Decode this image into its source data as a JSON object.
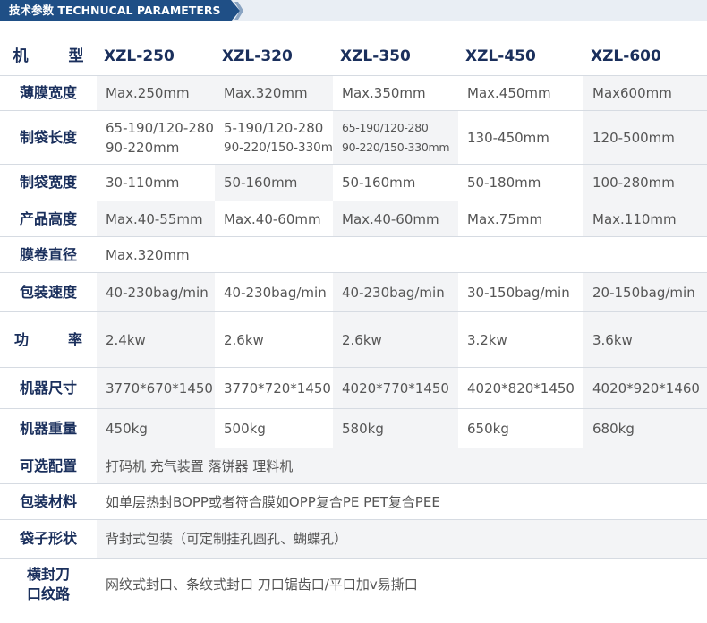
{
  "header": {
    "title": "技术参数 TECHNUCAL PARAMETERS"
  },
  "table": {
    "columns": [
      "机　型",
      "XZL-250",
      "XZL-320",
      "XZL-350",
      "XZL-450",
      "XZL-600"
    ],
    "rows": [
      {
        "label": "薄膜宽度",
        "values": [
          "Max.250mm",
          "Max.320mm",
          "Max.350mm",
          "Max.450mm",
          "Max600mm"
        ]
      },
      {
        "label": "制袋长度",
        "values": [
          [
            "65-190/120-280",
            "90-220mm"
          ],
          [
            "5-190/120-280",
            "90-220/150-330mm"
          ],
          [
            "65-190/120-280",
            "90-220/150-330mm"
          ],
          "130-450mm",
          "120-500mm"
        ]
      },
      {
        "label": "制袋宽度",
        "values": [
          "30-110mm",
          "50-160mm",
          "50-160mm",
          "50-180mm",
          "100-280mm"
        ]
      },
      {
        "label": "产品高度",
        "values": [
          "Max.40-55mm",
          "Max.40-60mm",
          "Max.40-60mm",
          "Max.75mm",
          "Max.110mm"
        ]
      },
      {
        "label": "膜卷直径",
        "values": [
          "Max.320mm"
        ]
      },
      {
        "label": "包装速度",
        "values": [
          "40-230bag/min",
          "40-230bag/min",
          "40-230bag/min",
          "30-150bag/min",
          "20-150bag/min"
        ]
      },
      {
        "label": "功　率",
        "values": [
          "2.4kw",
          "2.6kw",
          "2.6kw",
          "3.2kw",
          "3.6kw"
        ]
      },
      {
        "label": "机器尺寸",
        "values": [
          "3770*670*1450",
          "3770*720*1450",
          "4020*770*1450",
          "4020*820*1450",
          "4020*920*1460"
        ]
      },
      {
        "label": "机器重量",
        "values": [
          "450kg",
          "500kg",
          "580kg",
          "650kg",
          "680kg"
        ]
      },
      {
        "label": "可选配置",
        "values": [
          "打码机 充气装置 落饼器 理料机"
        ]
      },
      {
        "label": "包装材料",
        "values": [
          "如单层热封BOPP或者符合膜如OPP复合PE PET复合PEE"
        ]
      },
      {
        "label": "袋子形状",
        "values": [
          "背封式包装（可定制挂孔圆孔、蝴蝶孔）"
        ]
      },
      {
        "label": [
          "横封刀",
          "口纹路"
        ],
        "values": [
          "网纹式封口、条纹式封口 刀口锯齿口/平口加v易撕口"
        ]
      }
    ]
  },
  "colors": {
    "header_tab": "#1f4f86",
    "header_band": "#e9eef4",
    "label_text": "#1a2f5c",
    "value_text": "#555555",
    "row_shade": "#f3f4f6",
    "divider": "#d6dbe2"
  }
}
